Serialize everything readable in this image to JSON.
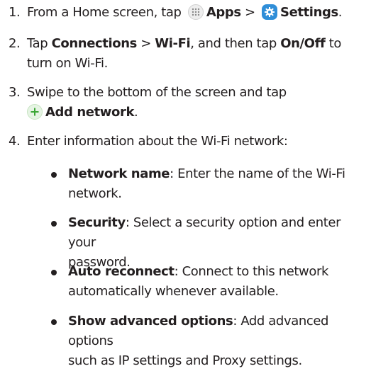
{
  "steps": [
    {
      "num": "1.",
      "pre": "From a Home screen, tap ",
      "apps_label": "Apps",
      "sep": " > ",
      "settings_label": "Settings",
      "end": "."
    },
    {
      "num": "2.",
      "line1_pre": "Tap ",
      "connections": "Connections",
      "sep": " > ",
      "wifi": "Wi-Fi",
      "mid": ", and then tap ",
      "onoff": "On/Off",
      "post": " to",
      "line2": "turn on Wi-Fi."
    },
    {
      "num": "3.",
      "line1": "Swipe to the bottom of the screen and tap",
      "add_label": "Add network",
      "end": "."
    },
    {
      "num": "4.",
      "text": "Enter information about the Wi-Fi network:"
    }
  ],
  "options": [
    {
      "term": "Network name",
      "line1": ": Enter the name of the Wi-Fi",
      "line2": "network."
    },
    {
      "term": "Security",
      "line1": ": Select a security option and enter your",
      "line2": "password."
    },
    {
      "term": "Auto reconnect",
      "line1": ": Connect to this network",
      "line2": "automatically whenever available."
    },
    {
      "term": "Show advanced options",
      "line1": ": Add advanced options",
      "line2": "such as IP settings and Proxy settings."
    }
  ],
  "icons": {
    "apps": "apps-grid-icon",
    "settings": "settings-gear-icon",
    "add": "add-plus-icon"
  },
  "colors": {
    "text": "#231f20",
    "settings_icon_bg": "#2f8ed8",
    "add_icon_plus": "#3aa635"
  }
}
